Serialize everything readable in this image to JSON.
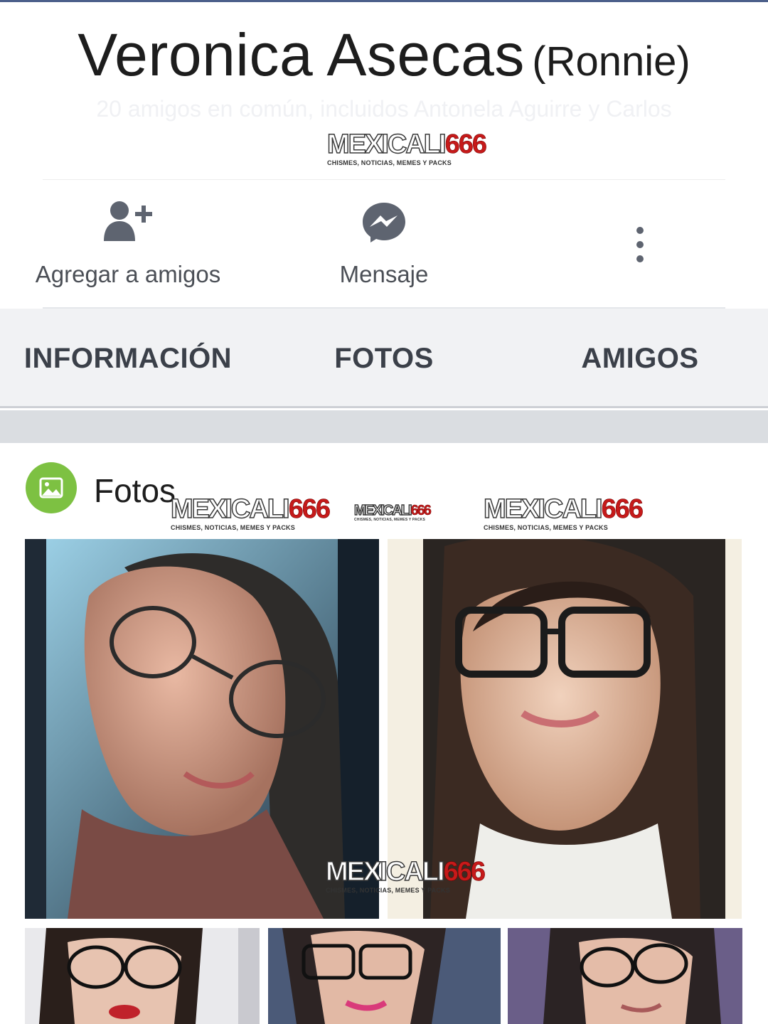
{
  "profile": {
    "name": "Veronica Asecas",
    "nickname": "(Ronnie)",
    "mutual_friends": "20 amigos en común, incluidos Antonela Aguirre y Carlos"
  },
  "watermark": {
    "brand_a": "MEXICALI",
    "brand_b": "666",
    "tagline": "CHISMES, NOTICIAS, MEMES Y PACKS"
  },
  "actions": {
    "add_friend": {
      "label": "Agregar a amigos",
      "icon": "add-friend-icon"
    },
    "message": {
      "label": "Mensaje",
      "icon": "messenger-icon"
    },
    "more": {
      "icon": "more-vertical-icon"
    }
  },
  "tabs": [
    {
      "label": "INFORMACIÓN"
    },
    {
      "label": "FOTOS"
    },
    {
      "label": "AMIGOS"
    }
  ],
  "photos": {
    "title": "Fotos",
    "icon": "photo-icon"
  },
  "colors": {
    "photos_icon_bg": "#7dc142",
    "watermark_red": "#c61a1a",
    "tab_text": "#3b4049"
  }
}
